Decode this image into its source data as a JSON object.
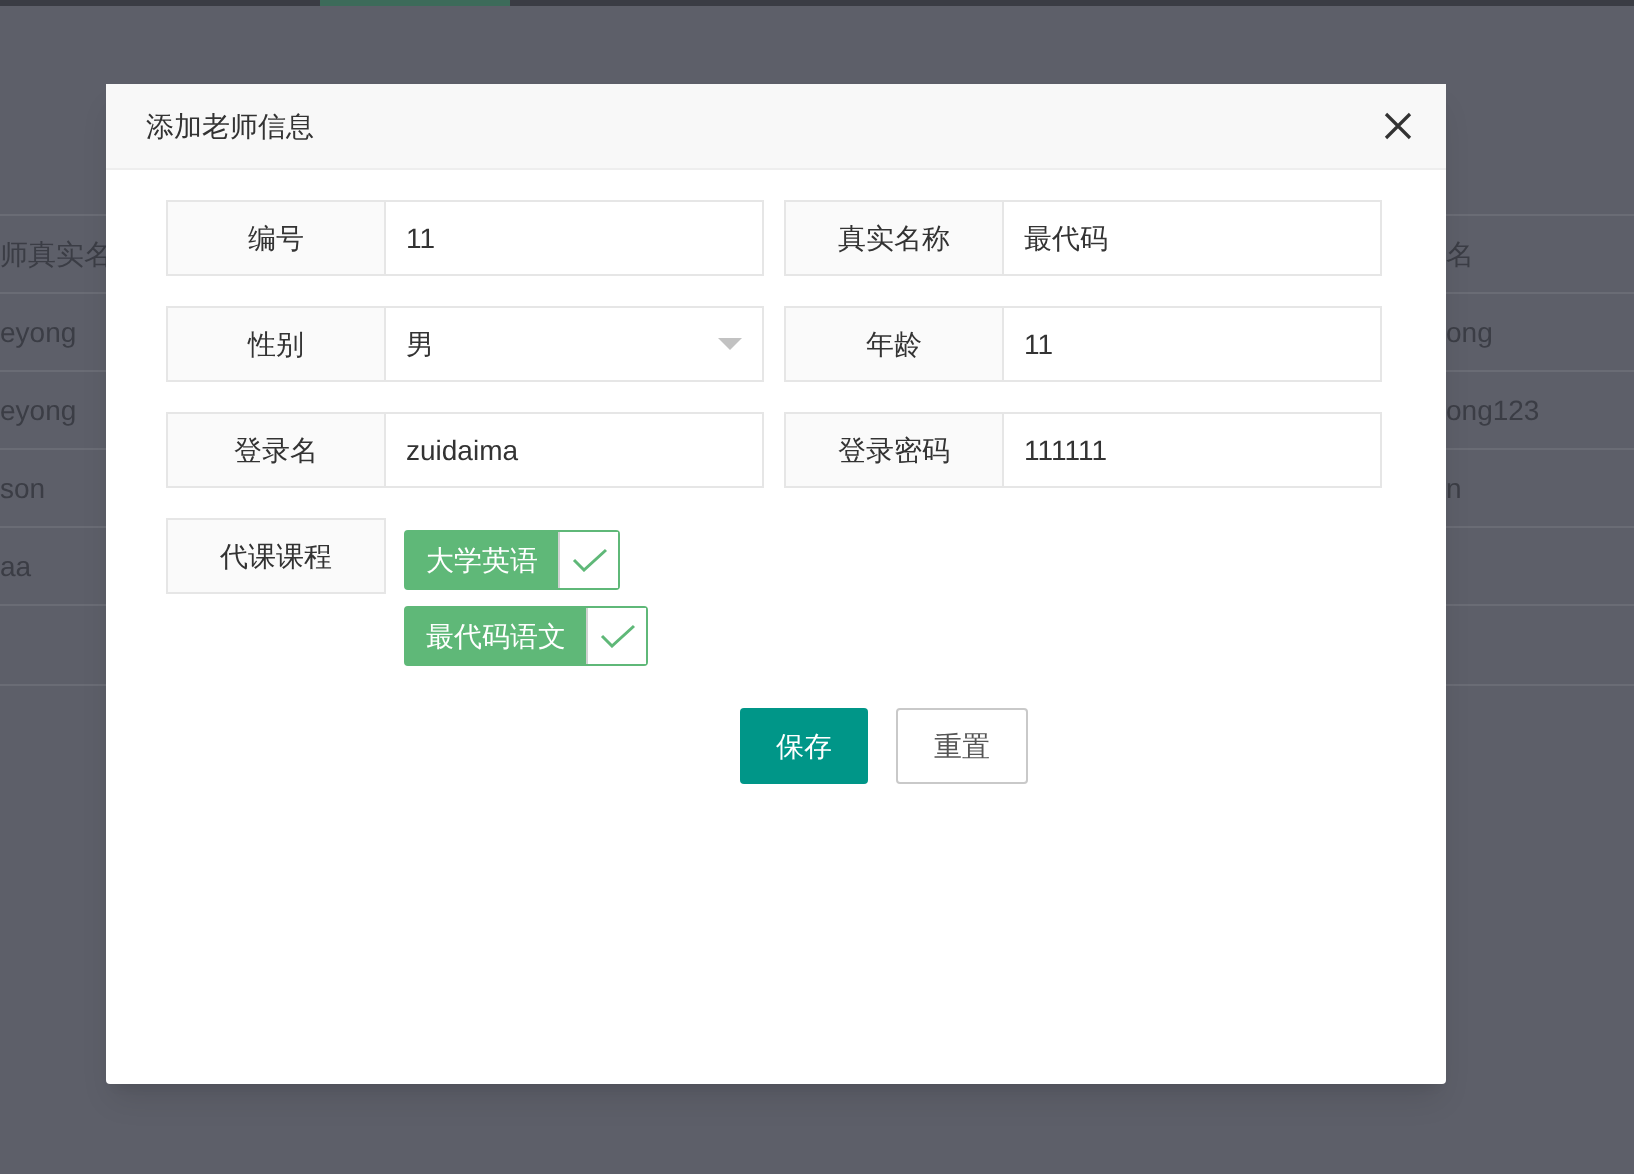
{
  "background_table": {
    "header": {
      "left": "师真实名",
      "right": "名"
    },
    "rows": [
      {
        "left": "eyong",
        "right": "ong"
      },
      {
        "left": "eyong",
        "right": "ong123"
      },
      {
        "left": "son",
        "right": "n"
      },
      {
        "left": "aa"
      }
    ]
  },
  "dialog": {
    "title": "添加老师信息",
    "fields": [
      {
        "label": "编号",
        "value": "11",
        "kind": "text"
      },
      {
        "label": "真实名称",
        "value": "最代码",
        "kind": "text"
      },
      {
        "label": "性别",
        "value": "男",
        "kind": "select"
      },
      {
        "label": "年龄",
        "value": "11",
        "kind": "text"
      },
      {
        "label": "登录名",
        "value": "zuidaima",
        "kind": "text"
      },
      {
        "label": "登录密码",
        "value": "111111",
        "kind": "text"
      }
    ],
    "courses": {
      "label": "代课课程",
      "options": [
        {
          "label": "大学英语",
          "checked": true
        },
        {
          "label": "最代码语文",
          "checked": true
        }
      ]
    },
    "buttons": [
      {
        "label": "保存",
        "kind": "primary"
      },
      {
        "label": "重置",
        "kind": "secondary"
      }
    ]
  }
}
